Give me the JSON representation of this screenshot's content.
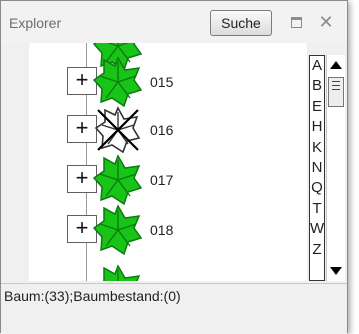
{
  "window": {
    "title": "Explorer"
  },
  "toolbar": {
    "search_label": "Suche",
    "restore_icon": "restore-icon",
    "close_icon": "close-icon"
  },
  "tree": {
    "nodes": [
      {
        "label": "",
        "expand": "+",
        "icon": "tree-icon",
        "state": "partial-top"
      },
      {
        "label": "015",
        "expand": "+",
        "icon": "tree-icon",
        "state": "normal"
      },
      {
        "label": "016",
        "expand": "+",
        "icon": "tree-removed-icon",
        "state": "removed"
      },
      {
        "label": "017",
        "expand": "+",
        "icon": "tree-icon",
        "state": "normal"
      },
      {
        "label": "018",
        "expand": "+",
        "icon": "tree-icon",
        "state": "normal"
      },
      {
        "label": "",
        "expand": "",
        "icon": "tree-icon",
        "state": "partial-bottom"
      }
    ]
  },
  "alphabet_index": [
    "A",
    "B",
    "E",
    "H",
    "K",
    "N",
    "Q",
    "T",
    "W",
    "Z"
  ],
  "status": {
    "text": "Baum:(33);Baumbestand:(0)"
  },
  "colors": {
    "tree_green": "#19c419",
    "tree_outline": "#0d7a0d",
    "removed_outline": "#333333"
  }
}
